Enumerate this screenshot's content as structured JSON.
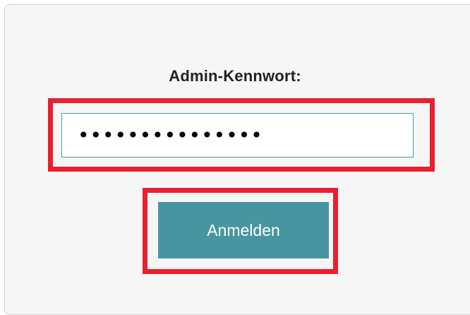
{
  "login": {
    "password_label": "Admin-Kennwort:",
    "password_value": "•••••••••••••••",
    "submit_label": "Anmelden"
  },
  "colors": {
    "highlight": "#e8202f",
    "button": "#4795a0",
    "input_border": "#4a9aa5",
    "panel_bg": "#f6f6f6"
  }
}
